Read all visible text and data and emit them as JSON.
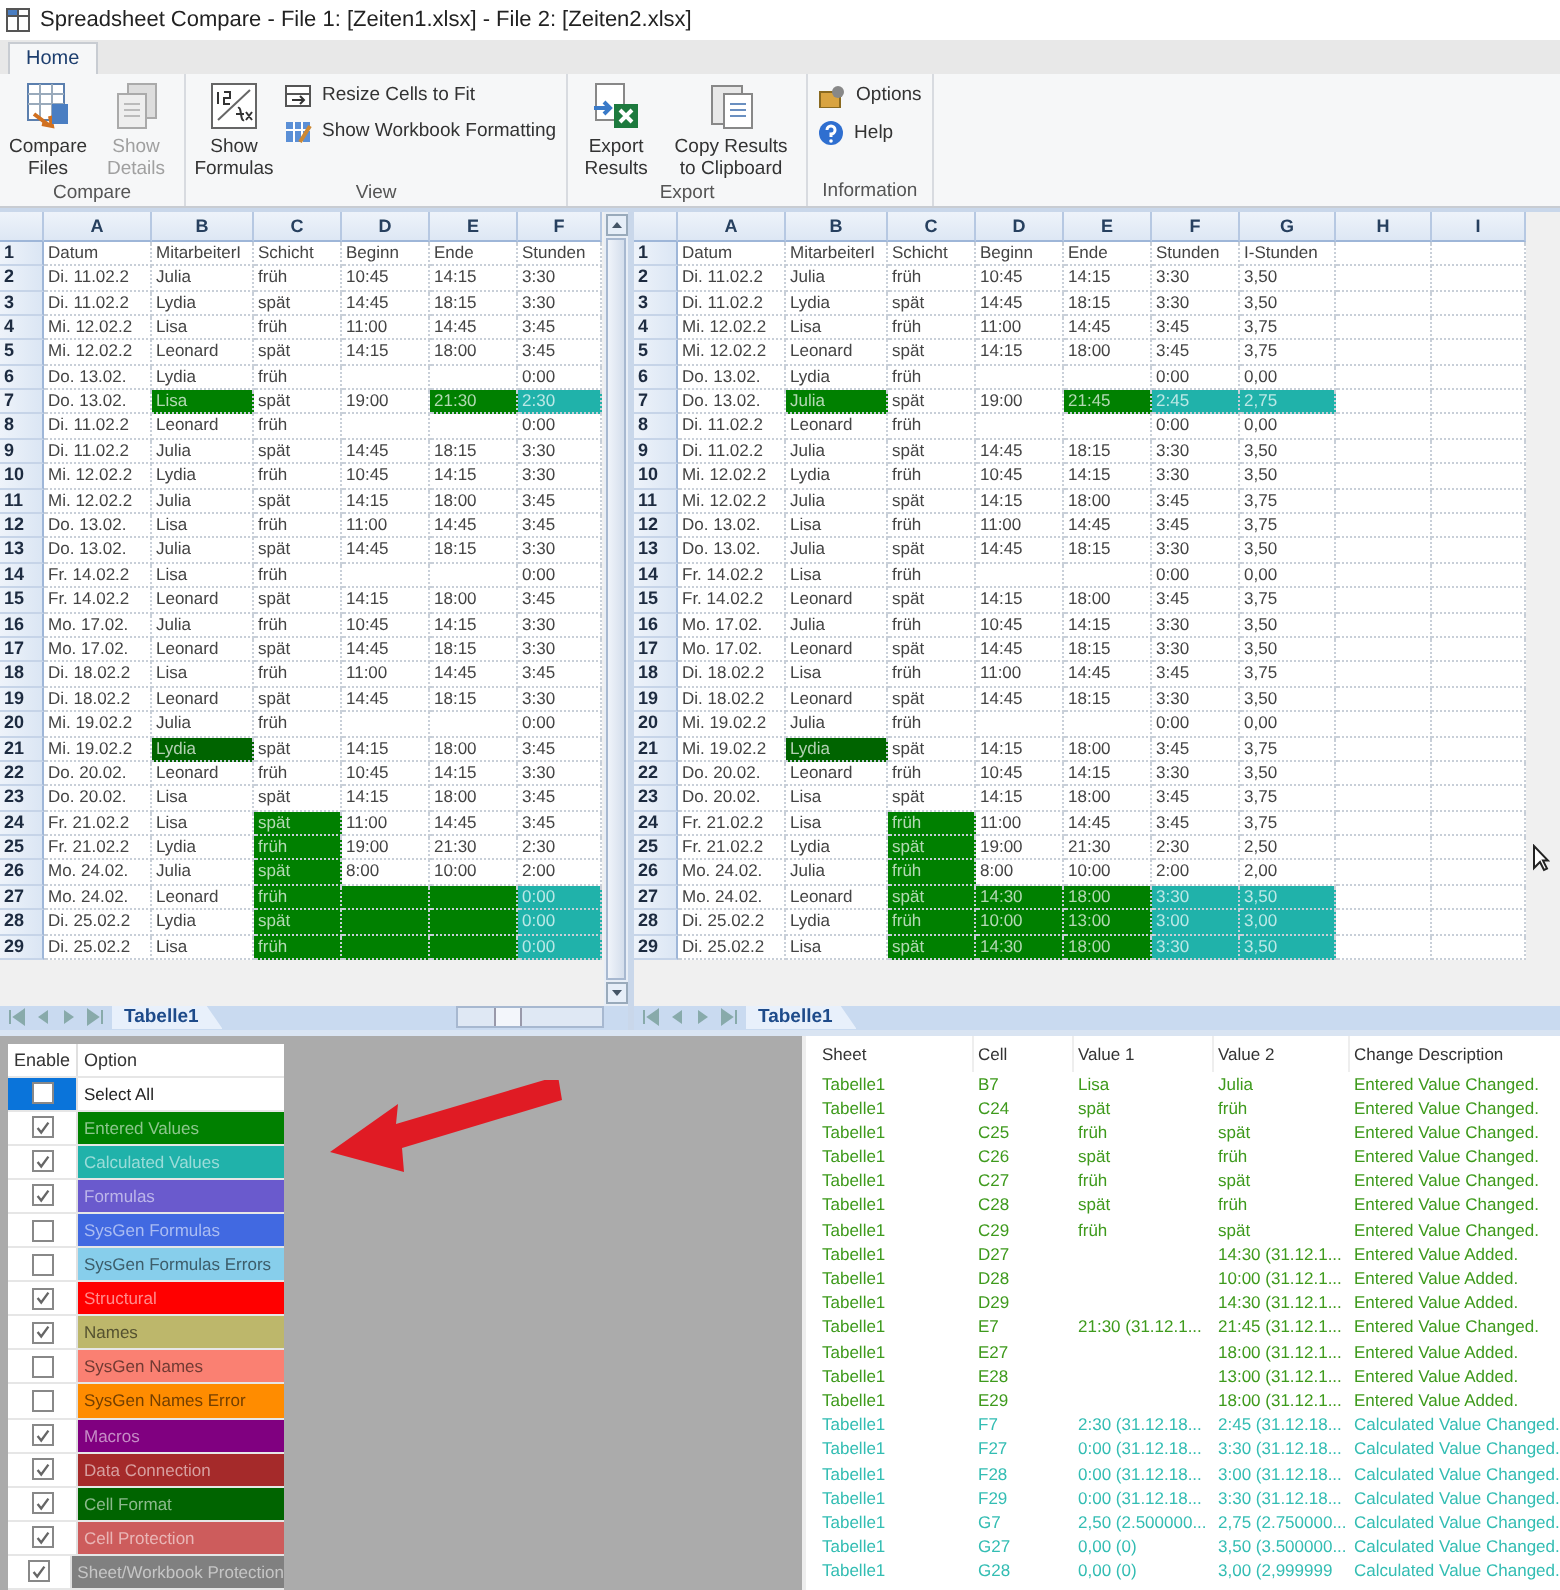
{
  "window": {
    "title": "Spreadsheet Compare - File 1: [Zeiten1.xlsx] - File 2: [Zeiten2.xlsx]"
  },
  "ribbon_tabs": [
    {
      "label": "Home",
      "selected": true
    }
  ],
  "ribbon_groups": [
    {
      "label": "Compare",
      "buttons": [
        {
          "label": "Compare Files",
          "kind": "large",
          "disabled": false
        },
        {
          "label": "Show Details",
          "kind": "large",
          "disabled": true
        }
      ]
    },
    {
      "label": "View",
      "buttons": [
        {
          "label": "Show Formulas",
          "kind": "large",
          "disabled": false
        },
        {
          "label": "Resize Cells to Fit",
          "kind": "small",
          "disabled": false
        },
        {
          "label": "Show Workbook Formatting",
          "kind": "small",
          "disabled": false
        }
      ]
    },
    {
      "label": "Export",
      "buttons": [
        {
          "label": "Export Results",
          "kind": "large",
          "disabled": false
        },
        {
          "label": "Copy Results to Clipboard",
          "kind": "large",
          "disabled": false
        }
      ]
    },
    {
      "label": "Information",
      "buttons": [
        {
          "label": "Options",
          "kind": "small",
          "disabled": false
        },
        {
          "label": "Help",
          "kind": "small",
          "disabled": false
        }
      ]
    }
  ],
  "left_grid": {
    "columns": [
      "A",
      "B",
      "C",
      "D",
      "E",
      "F"
    ],
    "sheet_tab": "Tabelle1",
    "rows": [
      {
        "n": "1",
        "cells": [
          "Datum",
          "MitarbeiterI",
          "Schicht",
          "Beginn",
          "Ende",
          "Stunden"
        ]
      },
      {
        "n": "2",
        "cells": [
          "Di. 11.02.2",
          "Julia",
          "früh",
          "10:45",
          "14:15",
          "3:30"
        ]
      },
      {
        "n": "3",
        "cells": [
          "Di. 11.02.2",
          "Lydia",
          "spät",
          "14:45",
          "18:15",
          "3:30"
        ]
      },
      {
        "n": "4",
        "cells": [
          "Mi. 12.02.2",
          "Lisa",
          "früh",
          "11:00",
          "14:45",
          "3:45"
        ]
      },
      {
        "n": "5",
        "cells": [
          "Mi. 12.02.2",
          "Leonard",
          "spät",
          "14:15",
          "18:00",
          "3:45"
        ]
      },
      {
        "n": "6",
        "cells": [
          "Do. 13.02.",
          "Lydia",
          "früh",
          null,
          null,
          "0:00"
        ]
      },
      {
        "n": "7",
        "cells": [
          "Do. 13.02.",
          {
            "value": "Lisa",
            "color": "#008000"
          },
          "spät",
          "19:00",
          {
            "value": "21:30",
            "color": "#008000"
          },
          {
            "value": "2:30",
            "color": "#20b2aa"
          }
        ]
      },
      {
        "n": "8",
        "cells": [
          "Di. 11.02.2",
          "Leonard",
          "früh",
          null,
          null,
          "0:00"
        ]
      },
      {
        "n": "9",
        "cells": [
          "Di. 11.02.2",
          "Julia",
          "spät",
          "14:45",
          "18:15",
          "3:30"
        ]
      },
      {
        "n": "10",
        "cells": [
          "Mi. 12.02.2",
          "Lydia",
          "früh",
          "10:45",
          "14:15",
          "3:30"
        ]
      },
      {
        "n": "11",
        "cells": [
          "Mi. 12.02.2",
          "Julia",
          "spät",
          "14:15",
          "18:00",
          "3:45"
        ]
      },
      {
        "n": "12",
        "cells": [
          "Do. 13.02.",
          "Lisa",
          "früh",
          "11:00",
          "14:45",
          "3:45"
        ]
      },
      {
        "n": "13",
        "cells": [
          "Do. 13.02.",
          "Julia",
          "spät",
          "14:45",
          "18:15",
          "3:30"
        ]
      },
      {
        "n": "14",
        "cells": [
          "Fr. 14.02.2",
          "Lisa",
          "früh",
          null,
          null,
          "0:00"
        ]
      },
      {
        "n": "15",
        "cells": [
          "Fr. 14.02.2",
          "Leonard",
          "spät",
          "14:15",
          "18:00",
          "3:45"
        ]
      },
      {
        "n": "16",
        "cells": [
          "Mo. 17.02.",
          "Julia",
          "früh",
          "10:45",
          "14:15",
          "3:30"
        ]
      },
      {
        "n": "17",
        "cells": [
          "Mo. 17.02.",
          "Leonard",
          "spät",
          "14:45",
          "18:15",
          "3:30"
        ]
      },
      {
        "n": "18",
        "cells": [
          "Di. 18.02.2",
          "Lisa",
          "früh",
          "11:00",
          "14:45",
          "3:45"
        ]
      },
      {
        "n": "19",
        "cells": [
          "Di. 18.02.2",
          "Leonard",
          "spät",
          "14:45",
          "18:15",
          "3:30"
        ]
      },
      {
        "n": "20",
        "cells": [
          "Mi. 19.02.2",
          "Julia",
          "früh",
          null,
          null,
          "0:00"
        ]
      },
      {
        "n": "21",
        "cells": [
          "Mi. 19.02.2",
          {
            "value": "Lydia",
            "color": "#006400"
          },
          "spät",
          "14:15",
          "18:00",
          "3:45"
        ]
      },
      {
        "n": "22",
        "cells": [
          "Do. 20.02.",
          "Leonard",
          "früh",
          "10:45",
          "14:15",
          "3:30"
        ]
      },
      {
        "n": "23",
        "cells": [
          "Do. 20.02.",
          "Lisa",
          "spät",
          "14:15",
          "18:00",
          "3:45"
        ]
      },
      {
        "n": "24",
        "cells": [
          "Fr. 21.02.2",
          "Lisa",
          {
            "value": "spät",
            "color": "#008000"
          },
          "11:00",
          "14:45",
          "3:45"
        ]
      },
      {
        "n": "25",
        "cells": [
          "Fr. 21.02.2",
          "Lydia",
          {
            "value": "früh",
            "color": "#008000"
          },
          "19:00",
          "21:30",
          "2:30"
        ]
      },
      {
        "n": "26",
        "cells": [
          "Mo. 24.02.",
          "Julia",
          {
            "value": "spät",
            "color": "#008000"
          },
          "8:00",
          "10:00",
          "2:00"
        ]
      },
      {
        "n": "27",
        "cells": [
          "Mo. 24.02.",
          "Leonard",
          {
            "value": "früh",
            "color": "#008000"
          },
          {
            "color": "#008000"
          },
          {
            "color": "#008000"
          },
          {
            "value": "0:00",
            "color": "#20b2aa"
          }
        ]
      },
      {
        "n": "28",
        "cells": [
          "Di. 25.02.2",
          "Lydia",
          {
            "value": "spät",
            "color": "#008000"
          },
          {
            "color": "#008000"
          },
          {
            "color": "#008000"
          },
          {
            "value": "0:00",
            "color": "#20b2aa"
          }
        ]
      },
      {
        "n": "29",
        "cells": [
          "Di. 25.02.2",
          "Lisa",
          {
            "value": "früh",
            "color": "#008000"
          },
          {
            "color": "#008000"
          },
          {
            "color": "#008000"
          },
          {
            "value": "0:00",
            "color": "#20b2aa"
          }
        ]
      }
    ]
  },
  "right_grid": {
    "columns": [
      "A",
      "B",
      "C",
      "D",
      "E",
      "F",
      "G",
      "H",
      "I"
    ],
    "sheet_tab": "Tabelle1",
    "rows": [
      {
        "n": "1",
        "cells": [
          "Datum",
          "MitarbeiterI",
          "Schicht",
          "Beginn",
          "Ende",
          "Stunden",
          "I-Stunden"
        ]
      },
      {
        "n": "2",
        "cells": [
          "Di. 11.02.2",
          "Julia",
          "früh",
          "10:45",
          "14:15",
          "3:30",
          "3,50"
        ]
      },
      {
        "n": "3",
        "cells": [
          "Di. 11.02.2",
          "Lydia",
          "spät",
          "14:45",
          "18:15",
          "3:30",
          "3,50"
        ]
      },
      {
        "n": "4",
        "cells": [
          "Mi. 12.02.2",
          "Lisa",
          "früh",
          "11:00",
          "14:45",
          "3:45",
          "3,75"
        ]
      },
      {
        "n": "5",
        "cells": [
          "Mi. 12.02.2",
          "Leonard",
          "spät",
          "14:15",
          "18:00",
          "3:45",
          "3,75"
        ]
      },
      {
        "n": "6",
        "cells": [
          "Do. 13.02.",
          "Lydia",
          "früh",
          null,
          null,
          "0:00",
          "0,00"
        ]
      },
      {
        "n": "7",
        "cells": [
          "Do. 13.02.",
          {
            "value": "Julia",
            "color": "#008000"
          },
          "spät",
          "19:00",
          {
            "value": "21:45",
            "color": "#008000"
          },
          {
            "value": "2:45",
            "color": "#20b2aa"
          },
          {
            "value": "2,75",
            "color": "#20b2aa"
          }
        ]
      },
      {
        "n": "8",
        "cells": [
          "Di. 11.02.2",
          "Leonard",
          "früh",
          null,
          null,
          "0:00",
          "0,00"
        ]
      },
      {
        "n": "9",
        "cells": [
          "Di. 11.02.2",
          "Julia",
          "spät",
          "14:45",
          "18:15",
          "3:30",
          "3,50"
        ]
      },
      {
        "n": "10",
        "cells": [
          "Mi. 12.02.2",
          "Lydia",
          "früh",
          "10:45",
          "14:15",
          "3:30",
          "3,50"
        ]
      },
      {
        "n": "11",
        "cells": [
          "Mi. 12.02.2",
          "Julia",
          "spät",
          "14:15",
          "18:00",
          "3:45",
          "3,75"
        ]
      },
      {
        "n": "12",
        "cells": [
          "Do. 13.02.",
          "Lisa",
          "früh",
          "11:00",
          "14:45",
          "3:45",
          "3,75"
        ]
      },
      {
        "n": "13",
        "cells": [
          "Do. 13.02.",
          "Julia",
          "spät",
          "14:45",
          "18:15",
          "3:30",
          "3,50"
        ]
      },
      {
        "n": "14",
        "cells": [
          "Fr. 14.02.2",
          "Lisa",
          "früh",
          null,
          null,
          "0:00",
          "0,00"
        ]
      },
      {
        "n": "15",
        "cells": [
          "Fr. 14.02.2",
          "Leonard",
          "spät",
          "14:15",
          "18:00",
          "3:45",
          "3,75"
        ]
      },
      {
        "n": "16",
        "cells": [
          "Mo. 17.02.",
          "Julia",
          "früh",
          "10:45",
          "14:15",
          "3:30",
          "3,50"
        ]
      },
      {
        "n": "17",
        "cells": [
          "Mo. 17.02.",
          "Leonard",
          "spät",
          "14:45",
          "18:15",
          "3:30",
          "3,50"
        ]
      },
      {
        "n": "18",
        "cells": [
          "Di. 18.02.2",
          "Lisa",
          "früh",
          "11:00",
          "14:45",
          "3:45",
          "3,75"
        ]
      },
      {
        "n": "19",
        "cells": [
          "Di. 18.02.2",
          "Leonard",
          "spät",
          "14:45",
          "18:15",
          "3:30",
          "3,50"
        ]
      },
      {
        "n": "20",
        "cells": [
          "Mi. 19.02.2",
          "Julia",
          "früh",
          null,
          null,
          "0:00",
          "0,00"
        ]
      },
      {
        "n": "21",
        "cells": [
          "Mi. 19.02.2",
          {
            "value": "Lydia",
            "color": "#006400"
          },
          "spät",
          "14:15",
          "18:00",
          "3:45",
          "3,75"
        ]
      },
      {
        "n": "22",
        "cells": [
          "Do. 20.02.",
          "Leonard",
          "früh",
          "10:45",
          "14:15",
          "3:30",
          "3,50"
        ]
      },
      {
        "n": "23",
        "cells": [
          "Do. 20.02.",
          "Lisa",
          "spät",
          "14:15",
          "18:00",
          "3:45",
          "3,75"
        ]
      },
      {
        "n": "24",
        "cells": [
          "Fr. 21.02.2",
          "Lisa",
          {
            "value": "früh",
            "color": "#008000"
          },
          "11:00",
          "14:45",
          "3:45",
          "3,75"
        ]
      },
      {
        "n": "25",
        "cells": [
          "Fr. 21.02.2",
          "Lydia",
          {
            "value": "spät",
            "color": "#008000"
          },
          "19:00",
          "21:30",
          "2:30",
          "2,50"
        ]
      },
      {
        "n": "26",
        "cells": [
          "Mo. 24.02.",
          "Julia",
          {
            "value": "früh",
            "color": "#008000"
          },
          "8:00",
          "10:00",
          "2:00",
          "2,00"
        ]
      },
      {
        "n": "27",
        "cells": [
          "Mo. 24.02.",
          "Leonard",
          {
            "value": "spät",
            "color": "#008000"
          },
          {
            "value": "14:30",
            "color": "#008000"
          },
          {
            "value": "18:00",
            "color": "#008000"
          },
          {
            "value": "3:30",
            "color": "#20b2aa"
          },
          {
            "value": "3,50",
            "color": "#20b2aa"
          }
        ]
      },
      {
        "n": "28",
        "cells": [
          "Di. 25.02.2",
          "Lydia",
          {
            "value": "früh",
            "color": "#008000"
          },
          {
            "value": "10:00",
            "color": "#008000"
          },
          {
            "value": "13:00",
            "color": "#008000"
          },
          {
            "value": "3:00",
            "color": "#20b2aa"
          },
          {
            "value": "3,00",
            "color": "#20b2aa"
          }
        ]
      },
      {
        "n": "29",
        "cells": [
          "Di. 25.02.2",
          "Lisa",
          {
            "value": "spät",
            "color": "#008000"
          },
          {
            "value": "14:30",
            "color": "#008000"
          },
          {
            "value": "18:00",
            "color": "#008000"
          },
          {
            "value": "3:30",
            "color": "#20b2aa"
          },
          {
            "value": "3,50",
            "color": "#20b2aa"
          }
        ]
      }
    ]
  },
  "options": {
    "columns": [
      "Enable",
      "Option"
    ],
    "rows": [
      {
        "label": "Select All",
        "checked": false,
        "selected": true
      },
      {
        "label": "Entered Values",
        "checked": true,
        "selected": false,
        "color": "#008000"
      },
      {
        "label": "Calculated Values",
        "checked": true,
        "selected": false,
        "color": "#20b2aa"
      },
      {
        "label": "Formulas",
        "checked": true,
        "selected": false,
        "color": "#6a5acd"
      },
      {
        "label": "SysGen Formulas",
        "checked": false,
        "selected": false,
        "color": "#4169e1"
      },
      {
        "label": "SysGen Formulas Errors",
        "checked": false,
        "selected": false,
        "color": "#87ceeb"
      },
      {
        "label": "Structural",
        "checked": true,
        "selected": false,
        "color": "#ff0000"
      },
      {
        "label": "Names",
        "checked": true,
        "selected": false,
        "color": "#bdb76b"
      },
      {
        "label": "SysGen Names",
        "checked": false,
        "selected": false,
        "color": "#fa8072"
      },
      {
        "label": "SysGen Names Error",
        "checked": false,
        "selected": false,
        "color": "#ff8c00"
      },
      {
        "label": "Macros",
        "checked": true,
        "selected": false,
        "color": "#800080"
      },
      {
        "label": "Data Connection",
        "checked": true,
        "selected": false,
        "color": "#a52a2a"
      },
      {
        "label": "Cell Format",
        "checked": true,
        "selected": false,
        "color": "#006400"
      },
      {
        "label": "Cell Protection",
        "checked": true,
        "selected": false,
        "color": "#cd5c5c"
      },
      {
        "label": "Sheet/Workbook Protection",
        "checked": true,
        "selected": false,
        "color": "#808080"
      }
    ]
  },
  "changes": {
    "columns": [
      "Sheet",
      "Cell",
      "Value 1",
      "Value 2",
      "Change Description"
    ],
    "rows": [
      {
        "sheet": "Tabelle1",
        "cell": "B7",
        "value_1": "Lisa",
        "value_2": "Julia",
        "description": "Entered Value Changed.",
        "kind": "entered"
      },
      {
        "sheet": "Tabelle1",
        "cell": "C24",
        "value_1": "spät",
        "value_2": "früh",
        "description": "Entered Value Changed.",
        "kind": "entered"
      },
      {
        "sheet": "Tabelle1",
        "cell": "C25",
        "value_1": "früh",
        "value_2": "spät",
        "description": "Entered Value Changed.",
        "kind": "entered"
      },
      {
        "sheet": "Tabelle1",
        "cell": "C26",
        "value_1": "spät",
        "value_2": "früh",
        "description": "Entered Value Changed.",
        "kind": "entered"
      },
      {
        "sheet": "Tabelle1",
        "cell": "C27",
        "value_1": "früh",
        "value_2": "spät",
        "description": "Entered Value Changed.",
        "kind": "entered"
      },
      {
        "sheet": "Tabelle1",
        "cell": "C28",
        "value_1": "spät",
        "value_2": "früh",
        "description": "Entered Value Changed.",
        "kind": "entered"
      },
      {
        "sheet": "Tabelle1",
        "cell": "C29",
        "value_1": "früh",
        "value_2": "spät",
        "description": "Entered Value Changed.",
        "kind": "entered"
      },
      {
        "sheet": "Tabelle1",
        "cell": "D27",
        "value_2": "14:30 (31.12.1...",
        "description": "Entered Value Added.",
        "kind": "entered"
      },
      {
        "sheet": "Tabelle1",
        "cell": "D28",
        "value_2": "10:00 (31.12.1...",
        "description": "Entered Value Added.",
        "kind": "entered"
      },
      {
        "sheet": "Tabelle1",
        "cell": "D29",
        "value_2": "14:30 (31.12.1...",
        "description": "Entered Value Added.",
        "kind": "entered"
      },
      {
        "sheet": "Tabelle1",
        "cell": "E7",
        "value_1": "21:30 (31.12.1...",
        "value_2": "21:45 (31.12.1...",
        "description": "Entered Value Changed.",
        "kind": "entered"
      },
      {
        "sheet": "Tabelle1",
        "cell": "E27",
        "value_2": "18:00 (31.12.1...",
        "description": "Entered Value Added.",
        "kind": "entered"
      },
      {
        "sheet": "Tabelle1",
        "cell": "E28",
        "value_2": "13:00 (31.12.1...",
        "description": "Entered Value Added.",
        "kind": "entered"
      },
      {
        "sheet": "Tabelle1",
        "cell": "E29",
        "value_2": "18:00 (31.12.1...",
        "description": "Entered Value Added.",
        "kind": "entered"
      },
      {
        "sheet": "Tabelle1",
        "cell": "F7",
        "value_1": "2:30 (31.12.18...",
        "value_2": "2:45 (31.12.18...",
        "description": "Calculated Value Changed.",
        "kind": "calculated"
      },
      {
        "sheet": "Tabelle1",
        "cell": "F27",
        "value_1": "0:00 (31.12.18...",
        "value_2": "3:30 (31.12.18...",
        "description": "Calculated Value Changed.",
        "kind": "calculated"
      },
      {
        "sheet": "Tabelle1",
        "cell": "F28",
        "value_1": "0:00 (31.12.18...",
        "value_2": "3:00 (31.12.18...",
        "description": "Calculated Value Changed.",
        "kind": "calculated"
      },
      {
        "sheet": "Tabelle1",
        "cell": "F29",
        "value_1": "0:00 (31.12.18...",
        "value_2": "3:30 (31.12.18...",
        "description": "Calculated Value Changed.",
        "kind": "calculated"
      },
      {
        "sheet": "Tabelle1",
        "cell": "G7",
        "value_1": "2,50 (2.500000...",
        "value_2": "2,75 (2.750000...",
        "description": "Calculated Value Changed.",
        "kind": "calculated"
      },
      {
        "sheet": "Tabelle1",
        "cell": "G27",
        "value_1": "0,00 (0)",
        "value_2": "3,50 (3.500000...",
        "description": "Calculated Value Changed.",
        "kind": "calculated"
      },
      {
        "sheet": "Tabelle1",
        "cell": "G28",
        "value_1": "0,00 (0)",
        "value_2": "3,00 (2,999999",
        "description": "Calculated Value Changed.",
        "kind": "calculated"
      }
    ]
  }
}
